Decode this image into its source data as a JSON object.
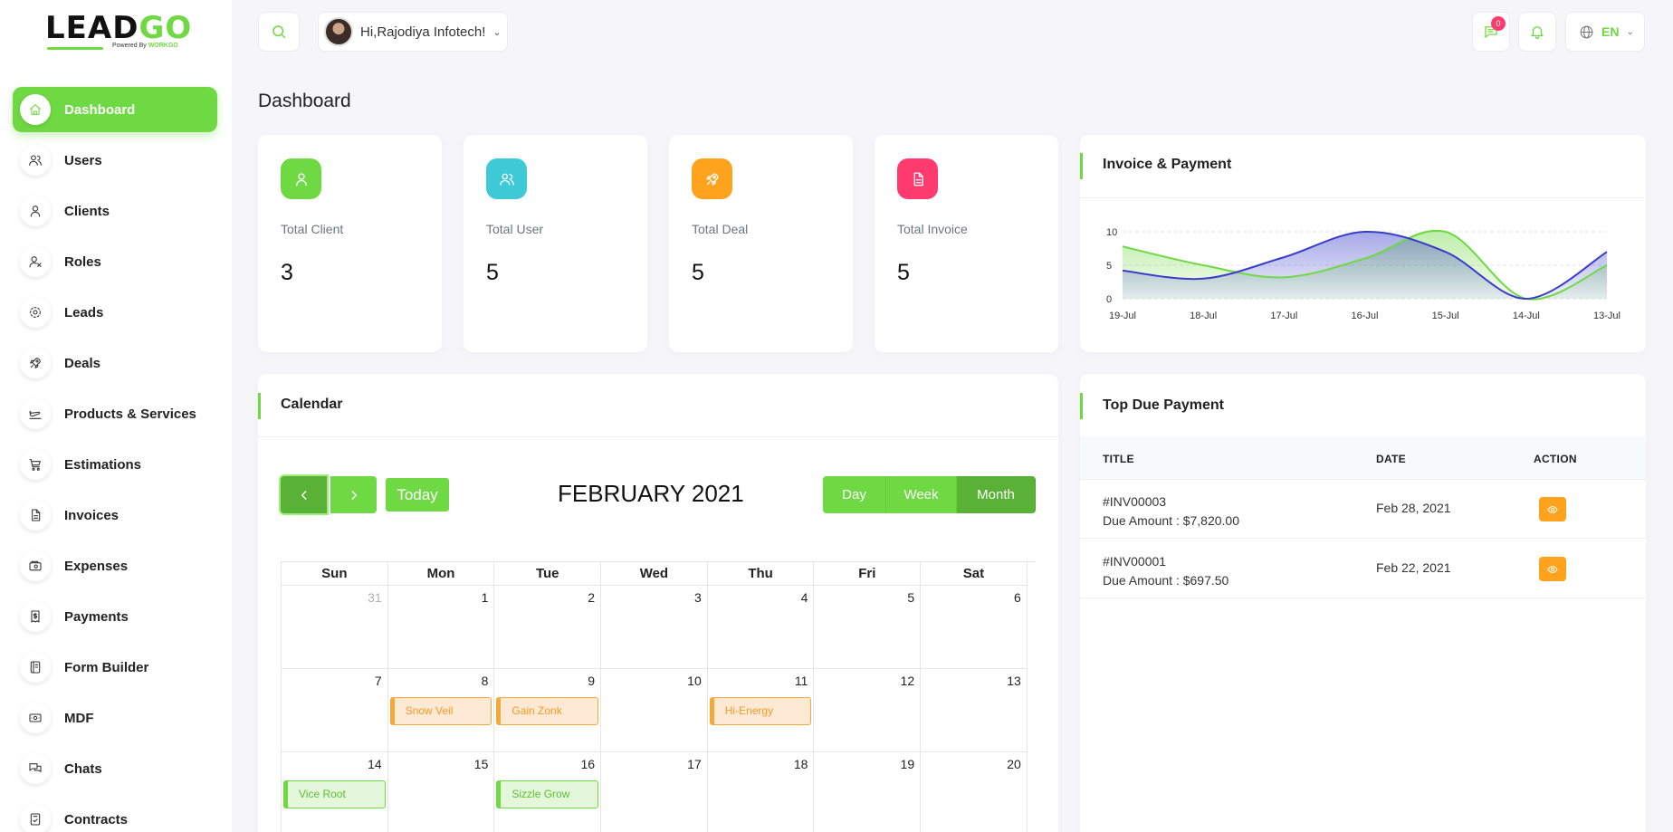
{
  "brand": {
    "logo_lead": "LEAD",
    "logo_go": "GO",
    "powered_by": "Powered By",
    "powered_company": "WORKGO"
  },
  "topbar": {
    "greeting": "Hi,Rajodiya Infotech!",
    "message_count": "0",
    "language": "EN"
  },
  "sidebar": {
    "items": [
      {
        "label": "Dashboard",
        "icon": "home-icon",
        "active": true
      },
      {
        "label": "Users",
        "icon": "users-icon"
      },
      {
        "label": "Clients",
        "icon": "user-icon"
      },
      {
        "label": "Roles",
        "icon": "user-x-icon"
      },
      {
        "label": "Leads",
        "icon": "target-icon"
      },
      {
        "label": "Deals",
        "icon": "rocket-icon"
      },
      {
        "label": "Products & Services",
        "icon": "plane-icon"
      },
      {
        "label": "Estimations",
        "icon": "cart-icon"
      },
      {
        "label": "Invoices",
        "icon": "file-icon"
      },
      {
        "label": "Expenses",
        "icon": "wallet-icon"
      },
      {
        "label": "Payments",
        "icon": "bill-icon"
      },
      {
        "label": "Form Builder",
        "icon": "notebook-icon"
      },
      {
        "label": "MDF",
        "icon": "cash-icon"
      },
      {
        "label": "Chats",
        "icon": "messages-icon"
      },
      {
        "label": "Contracts",
        "icon": "contract-icon"
      }
    ]
  },
  "page": {
    "title": "Dashboard"
  },
  "stats": [
    {
      "label": "Total Client",
      "value": "3",
      "color": "#6fd943",
      "icon": "user-icon"
    },
    {
      "label": "Total User",
      "value": "5",
      "color": "#3ec9d6",
      "icon": "users-icon"
    },
    {
      "label": "Total Deal",
      "value": "5",
      "color": "#ffa21d",
      "icon": "rocket-icon"
    },
    {
      "label": "Total Invoice",
      "value": "5",
      "color": "#ff3a6e",
      "icon": "file-icon"
    }
  ],
  "invoice_payment": {
    "title": "Invoice & Payment",
    "chart_data": {
      "type": "area",
      "x": [
        "19-Jul",
        "18-Jul",
        "17-Jul",
        "16-Jul",
        "15-Jul",
        "14-Jul",
        "13-Jul"
      ],
      "ylim": [
        0,
        10
      ],
      "yticks": [
        "0",
        "5",
        "10"
      ],
      "series": [
        {
          "color": "#6fd943",
          "values": [
            7.8,
            5,
            3.2,
            6,
            10,
            0,
            5
          ]
        },
        {
          "color": "#3b3ec9",
          "values": [
            4.2,
            3,
            6.2,
            10,
            7,
            0,
            7
          ]
        }
      ]
    }
  },
  "calendar": {
    "title": "Calendar",
    "today_label": "Today",
    "month_title": "FEBRUARY 2021",
    "views": [
      "Day",
      "Week",
      "Month"
    ],
    "active_view": "Month",
    "weekdays": [
      "Sun",
      "Mon",
      "Tue",
      "Wed",
      "Thu",
      "Fri",
      "Sat"
    ],
    "weeks": [
      [
        {
          "d": "31",
          "other": true
        },
        {
          "d": "1"
        },
        {
          "d": "2"
        },
        {
          "d": "3"
        },
        {
          "d": "4"
        },
        {
          "d": "5"
        },
        {
          "d": "6"
        }
      ],
      [
        {
          "d": "7"
        },
        {
          "d": "8",
          "event": "Snow Veil",
          "color": "orange"
        },
        {
          "d": "9",
          "event": "Gain Zonk",
          "color": "orange"
        },
        {
          "d": "10"
        },
        {
          "d": "11",
          "event": "Hi-Energy",
          "color": "orange"
        },
        {
          "d": "12"
        },
        {
          "d": "13"
        }
      ],
      [
        {
          "d": "14",
          "event": "Vice Root",
          "color": "green"
        },
        {
          "d": "15"
        },
        {
          "d": "16",
          "event": "Sizzle Grow",
          "color": "green"
        },
        {
          "d": "17"
        },
        {
          "d": "18"
        },
        {
          "d": "19"
        },
        {
          "d": "20"
        }
      ]
    ]
  },
  "top_due": {
    "title": "Top Due Payment",
    "columns": [
      "TITLE",
      "DATE",
      "ACTION"
    ],
    "rows": [
      {
        "invoice": "#INV00003",
        "due": "Due Amount : $7,820.00",
        "date": "Feb 28, 2021"
      },
      {
        "invoice": "#INV00001",
        "due": "Due Amount : $697.50",
        "date": "Feb 22, 2021"
      }
    ]
  }
}
